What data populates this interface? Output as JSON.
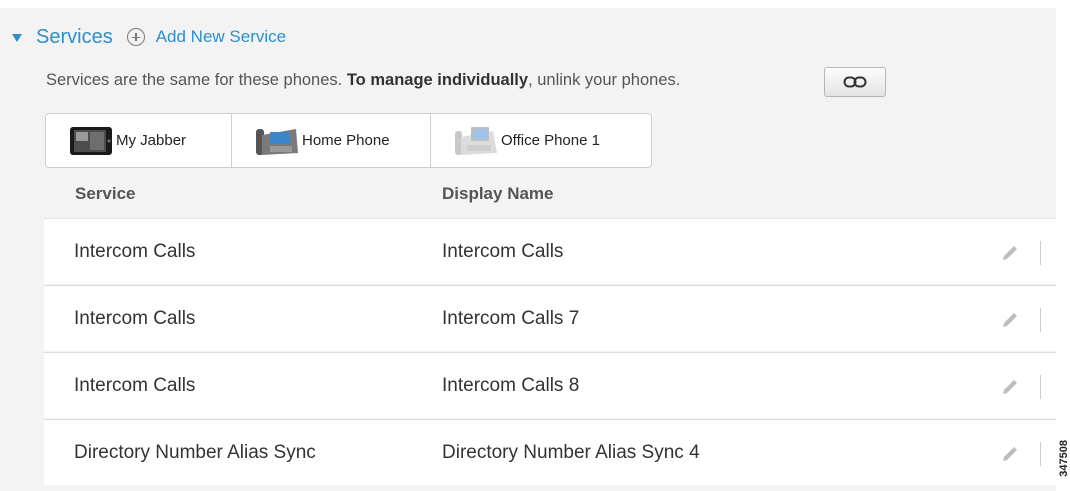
{
  "section": {
    "title": "Services",
    "add_label": "Add New Service",
    "info_prefix": "Services are the same for these phones. ",
    "info_bold": "To manage individually",
    "info_suffix": ", unlink your phones."
  },
  "tabs": [
    {
      "label": "My Jabber",
      "icon": "tablet-icon"
    },
    {
      "label": "Home Phone",
      "icon": "desk-phone-icon"
    },
    {
      "label": "Office Phone 1",
      "icon": "video-phone-icon"
    }
  ],
  "table": {
    "headers": {
      "service": "Service",
      "display_name": "Display Name"
    },
    "rows": [
      {
        "service": "Intercom Calls",
        "display_name": "Intercom Calls"
      },
      {
        "service": "Intercom Calls",
        "display_name": "Intercom Calls 7"
      },
      {
        "service": "Intercom Calls",
        "display_name": "Intercom Calls 8"
      },
      {
        "service": "Directory Number Alias Sync",
        "display_name": "Directory Number Alias Sync 4"
      }
    ]
  },
  "figure_id": "347508",
  "colors": {
    "accent": "#2e8fc8",
    "panel": "#f3f3f3",
    "row": "#ffffff"
  }
}
